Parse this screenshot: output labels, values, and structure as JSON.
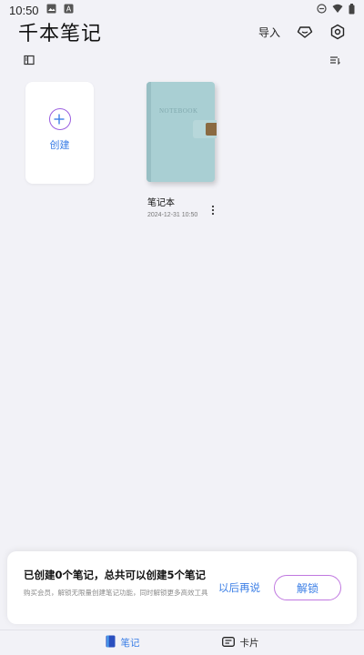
{
  "status_bar": {
    "time": "10:50"
  },
  "header": {
    "title": "千本笔记",
    "import_label": "导入"
  },
  "notes": [
    {
      "name": "笔记本",
      "date": "2024-12-31 10:50",
      "cover_text": "NOTEBOOK",
      "cover_color": "#a9cfd3"
    }
  ],
  "create_card": {
    "label": "创建"
  },
  "promo": {
    "title": "已创建0个笔记，总共可以创建5个笔记",
    "description": "购买会员，解锁无限量创建笔记功能，同时解锁更多高效工具",
    "later_label": "以后再说",
    "unlock_label": "解锁"
  },
  "bottom_nav": {
    "items": [
      {
        "label": "笔记",
        "icon": "notebook-icon",
        "active": true
      },
      {
        "label": "卡片",
        "icon": "card-icon",
        "active": false
      }
    ]
  },
  "colors": {
    "accent": "#3a7ee6",
    "gradient_border": "#c078e0",
    "background": "#f2f2f7"
  }
}
